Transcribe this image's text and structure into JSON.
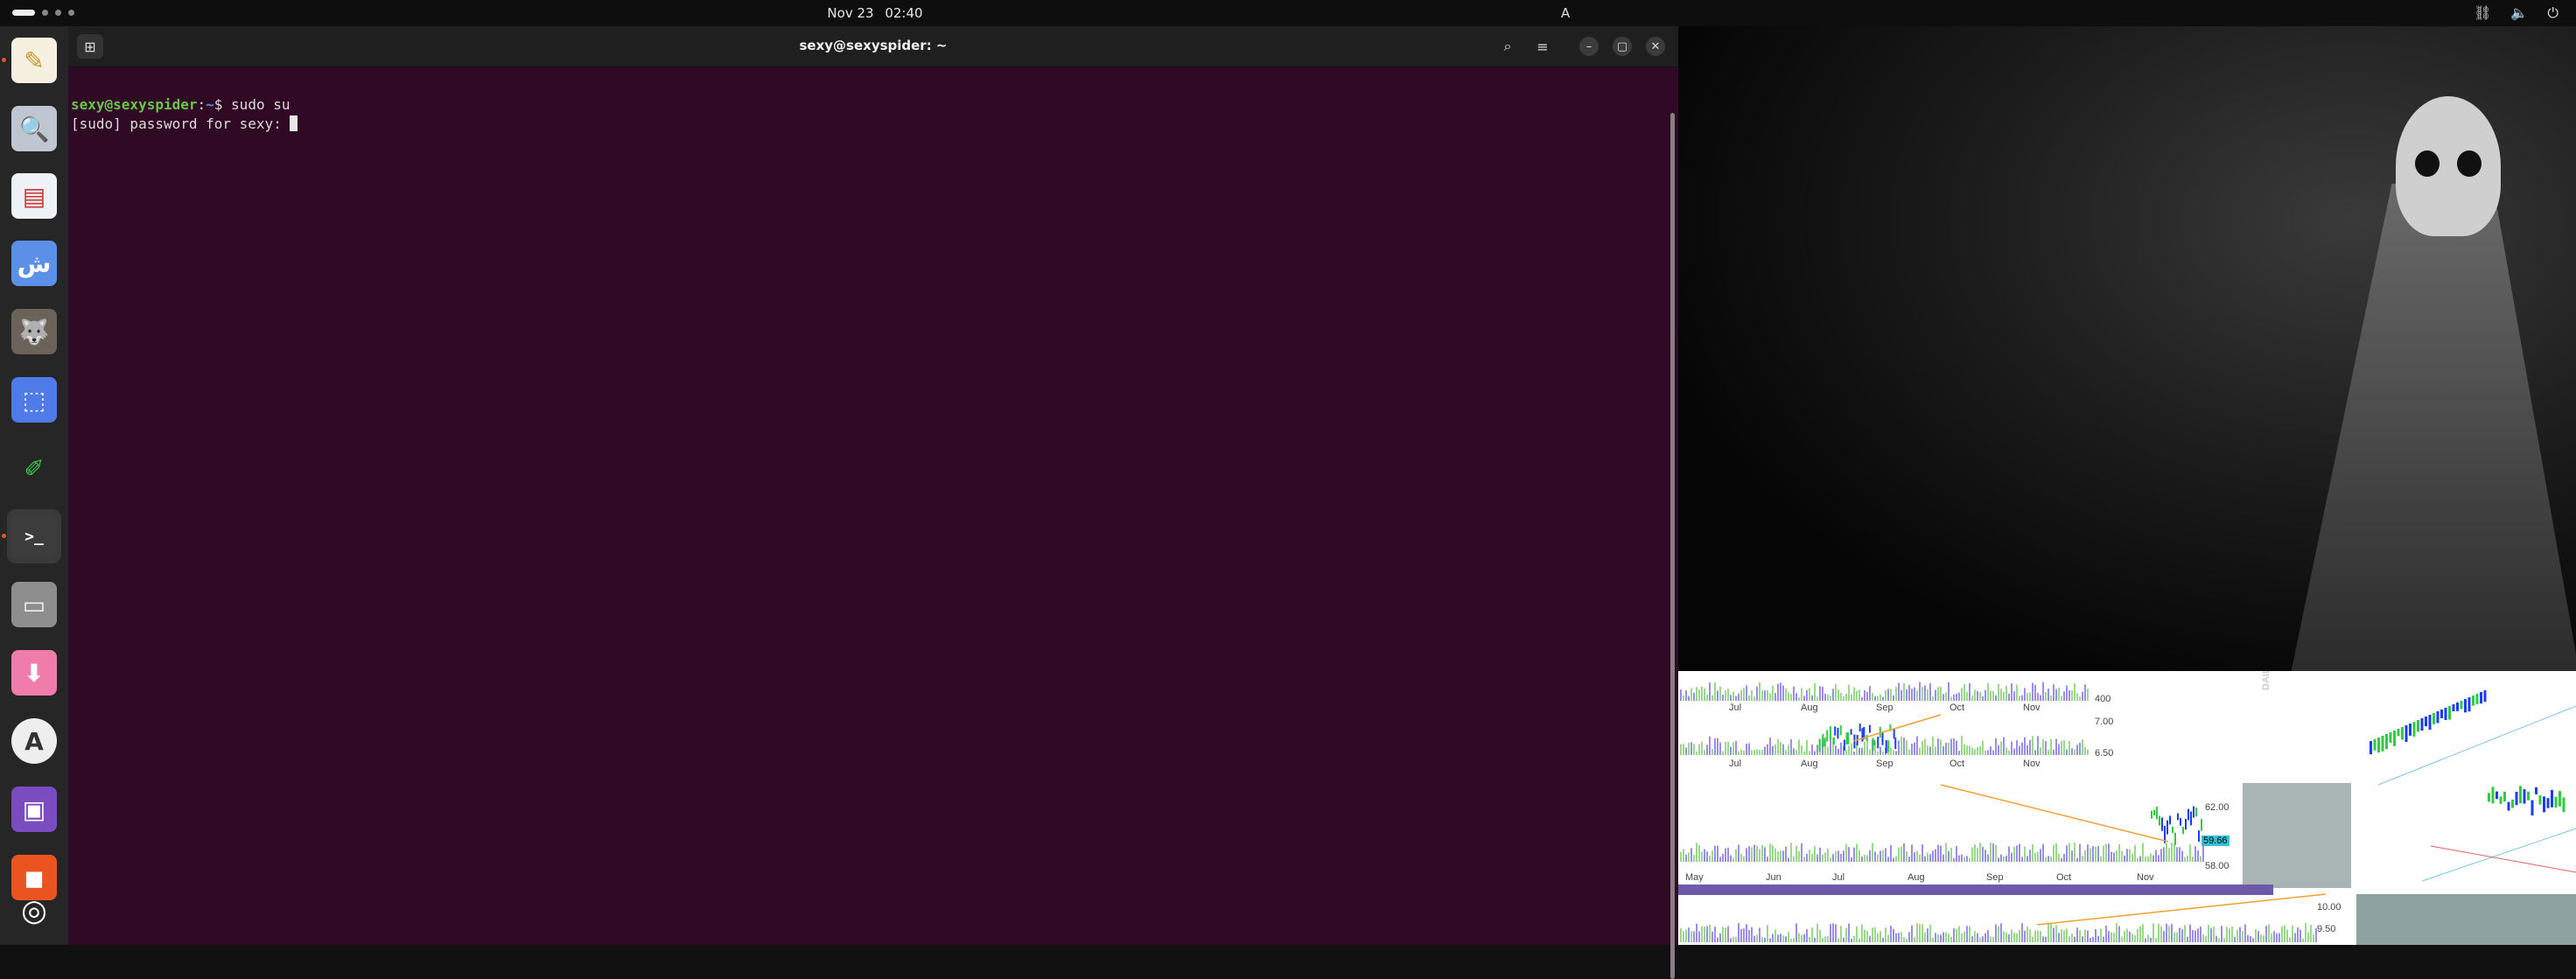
{
  "topbar": {
    "clock": {
      "date": "Nov 23",
      "time": "02:40"
    },
    "keyboard_indicator": "A"
  },
  "dock": {
    "items": [
      {
        "name": "text-editor",
        "icon": "text-editor-icon",
        "running": true
      },
      {
        "name": "image-viewer",
        "icon": "magnifier-icon",
        "running": false
      },
      {
        "name": "document-viewer",
        "icon": "document-viewer-icon",
        "running": false
      },
      {
        "name": "keyboard-layout",
        "icon": "keyboard-layout-icon",
        "running": false
      },
      {
        "name": "gimp",
        "icon": "gimp-icon",
        "running": false
      },
      {
        "name": "screenshot",
        "icon": "screenshot-icon",
        "running": false
      },
      {
        "name": "color-picker",
        "icon": "pen-icon",
        "running": false
      },
      {
        "name": "terminal",
        "icon": "terminal-icon",
        "running": true,
        "active": true
      },
      {
        "name": "files",
        "icon": "folder-icon",
        "running": false
      },
      {
        "name": "installer",
        "icon": "download-icon",
        "running": false
      },
      {
        "name": "software",
        "icon": "app-store-icon",
        "running": false
      },
      {
        "name": "remote-desktop",
        "icon": "monitor-icon",
        "running": false
      },
      {
        "name": "ubuntu-software",
        "icon": "bag-icon",
        "running": false
      },
      {
        "name": "show-apps",
        "icon": "ubuntu-logo-icon",
        "running": false
      }
    ]
  },
  "terminal": {
    "title": "sexy@sexyspider: ~",
    "lines": [
      {
        "user": "sexy@sexyspider",
        "sep": ":",
        "path": "~",
        "prompt": "$ ",
        "command": "sudo su"
      },
      {
        "text": "[sudo] password for sexy: "
      }
    ]
  },
  "charts": {
    "panel1": {
      "months": [
        "Jul",
        "Aug",
        "Sep",
        "Oct",
        "Nov"
      ],
      "y_ticks": [
        "400"
      ]
    },
    "panel2": {
      "months": [
        "Jul",
        "Aug",
        "Sep",
        "Oct",
        "Nov"
      ],
      "y_ticks": [
        "7.00",
        "6.50"
      ]
    },
    "panel3": {
      "months": [
        "May",
        "Jun",
        "Jul",
        "Aug",
        "Sep",
        "Oct",
        "Nov"
      ],
      "y_ticks": [
        "62.00",
        "58.00"
      ],
      "last_value": "59.66"
    },
    "panel4": {
      "y_ticks": [
        "10.00",
        "9.50"
      ]
    },
    "side_label": "DAILY",
    "colors": {
      "up": "#2ecc40",
      "down": "#1a3cff",
      "trend": "#f0a030",
      "volume": "#9b8cf0"
    }
  }
}
